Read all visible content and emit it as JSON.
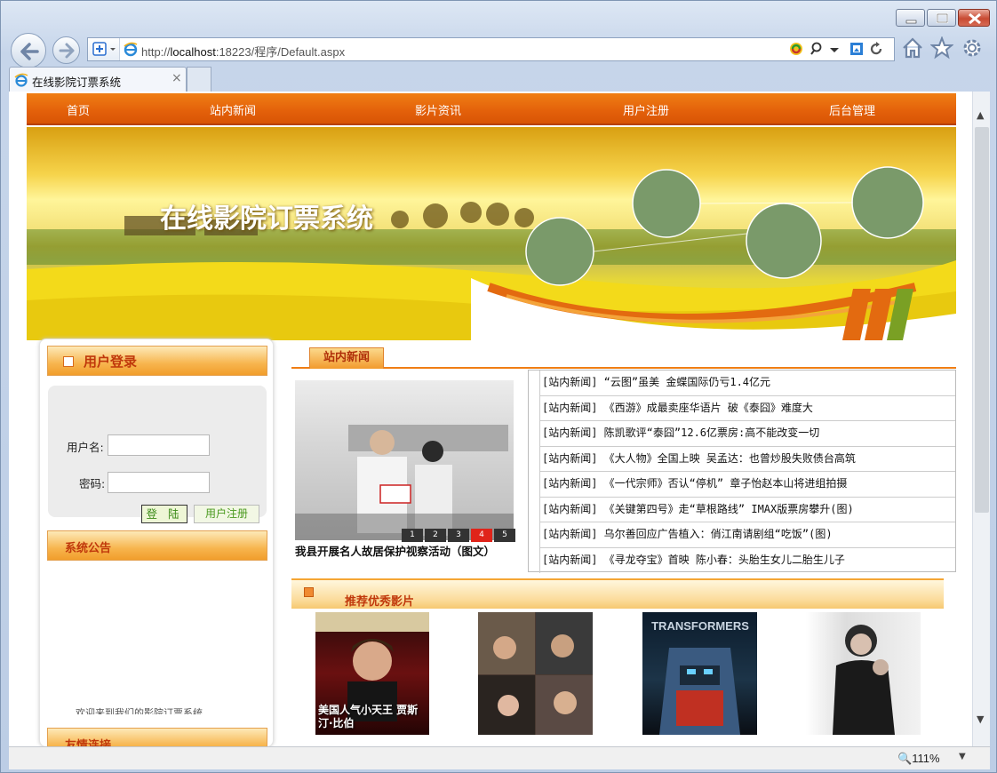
{
  "browser": {
    "url_prefix": "http://",
    "url_host": "localhost",
    "url_rest": ":18223/程序/Default.aspx",
    "tab_title": "在线影院订票系统",
    "zoom": "111%"
  },
  "menu": [
    "首页",
    "站内新闻",
    "影片资讯",
    "用户注册",
    "后台管理"
  ],
  "banner": {
    "title": "在线影院订票系统"
  },
  "login": {
    "title": "用户登录",
    "username_label": "用户名:",
    "password_label": "密码:",
    "login_button": "登  陆",
    "register_button": "用户注册"
  },
  "announcement": {
    "title": "系统公告",
    "text": "欢迎来到我们的影院订票系统"
  },
  "links": {
    "title": "友情连接"
  },
  "news": {
    "tab": "站内新闻",
    "photo_caption": "我县开展名人故居保护视察活动（图文）",
    "photo_pages": [
      "1",
      "2",
      "3",
      "4",
      "5"
    ],
    "photo_active": "4",
    "items": [
      "[站内新闻] “云图”虽美 金蝶国际仍亏1.4亿元",
      "[站内新闻] 《西游》成最卖座华语片 破《泰囧》难度大",
      "[站内新闻] 陈凯歌评“泰囧”12.6亿票房:高不能改变一切",
      "[站内新闻] 《大人物》全国上映 吴孟达：也曾炒股失败债台高筑",
      "[站内新闻] 《一代宗师》否认“停机” 章子怡赵本山将进组拍摄",
      "[站内新闻] 《关键第四号》走“草根路线” IMAX版票房攀升(图)",
      "[站内新闻] 乌尔善回应广告植入：俏江南请剧组“吃饭”(图)",
      "[站内新闻] 《寻龙夺宝》首映 陈小春：头胎生女儿二胎生儿子"
    ]
  },
  "recommend": {
    "title": "推荐优秀影片",
    "poster1_text": "美国人气小天王 贾斯汀·比伯",
    "poster3_text": "TRANSFORMERS"
  }
}
